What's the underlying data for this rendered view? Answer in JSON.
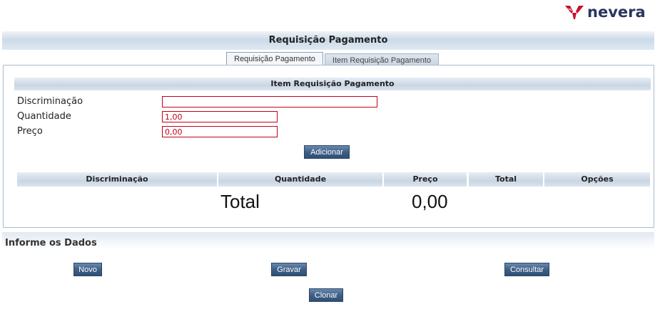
{
  "brand": {
    "name": "nevera",
    "color": "#2a3560",
    "mark_color": "#c8102e"
  },
  "page_title": "Requisição Pagamento",
  "tabs": [
    {
      "label": "Requisição Pagamento",
      "active": true
    },
    {
      "label": "Item Requisição Pagamento",
      "active": false
    }
  ],
  "item_form": {
    "header": "Item Requisição Pagamento",
    "fields": {
      "discriminacao": {
        "label": "Discriminação",
        "value": ""
      },
      "quantidade": {
        "label": "Quantidade",
        "value": "1,00"
      },
      "preco": {
        "label": "Preço",
        "value": "0,00"
      }
    },
    "add_button": "Adicionar"
  },
  "items_table": {
    "columns": [
      "Discriminação",
      "Quantidade",
      "Preço",
      "Total",
      "Opções"
    ],
    "rows": [],
    "total_label": "Total",
    "total_value": "0,00"
  },
  "dados_section": {
    "title": "Informe os Dados",
    "buttons": {
      "novo": "Novo",
      "gravar": "Gravar",
      "consultar": "Consultar",
      "clonar": "Clonar"
    }
  },
  "colors": {
    "error_border": "#c0001a",
    "button_blue": "#3f5f86",
    "header_blue": "#c9d6e3"
  }
}
